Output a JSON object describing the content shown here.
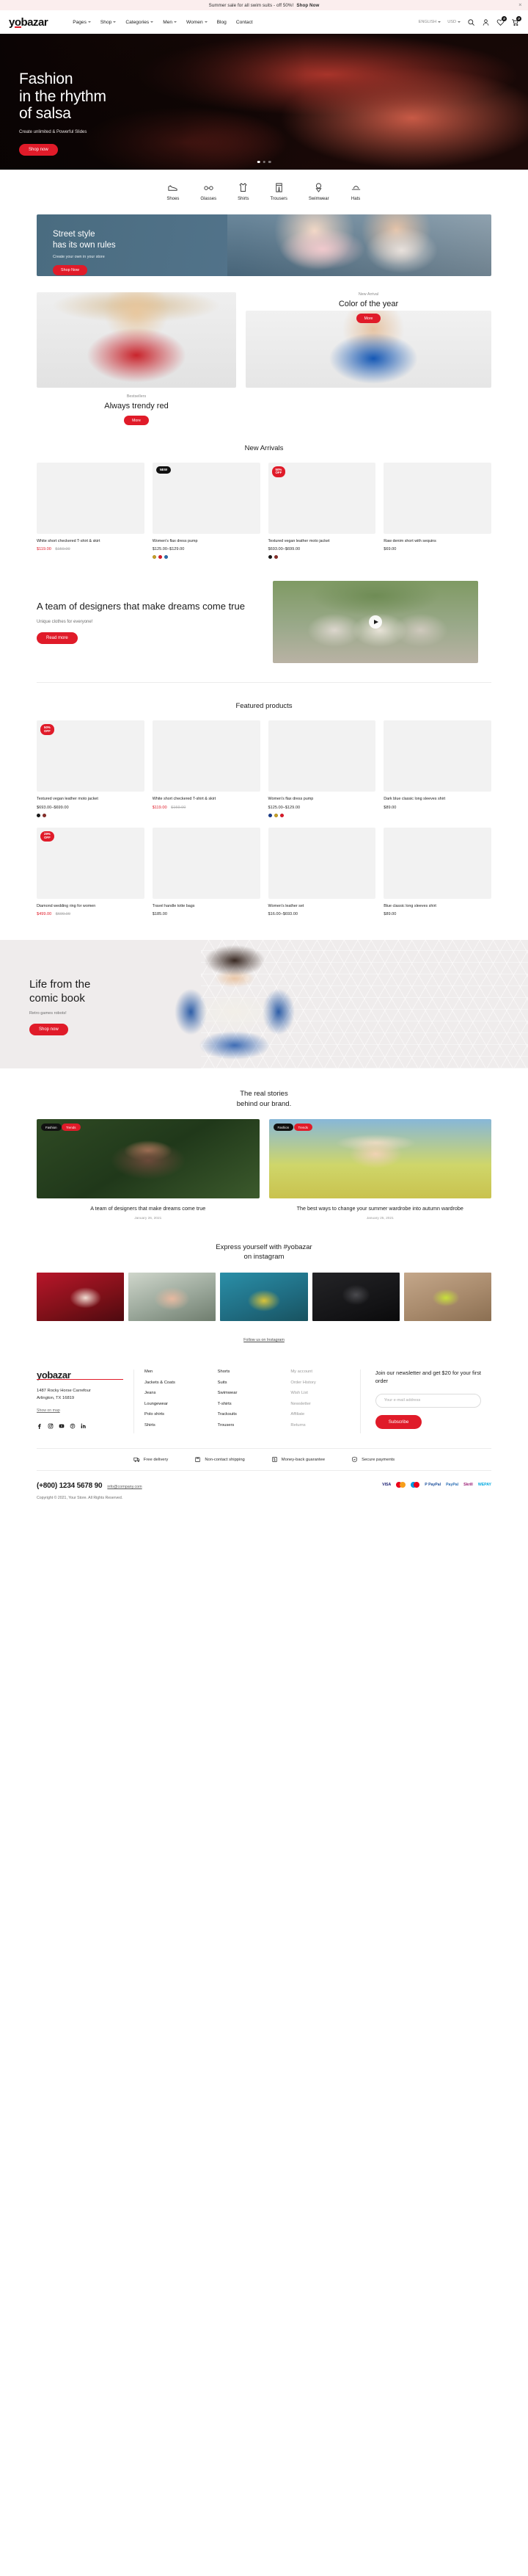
{
  "announce": {
    "text": "Summer sale for all swim suits - off 50%!",
    "cta": "Shop Now",
    "close_icon": "close-icon"
  },
  "header": {
    "logo": "yobazar",
    "nav": [
      {
        "label": "Pages",
        "has_caret": true
      },
      {
        "label": "Shop",
        "has_caret": true
      },
      {
        "label": "Categories",
        "has_caret": true
      },
      {
        "label": "Men",
        "has_caret": true
      },
      {
        "label": "Women",
        "has_caret": true
      },
      {
        "label": "Blog",
        "has_caret": false
      },
      {
        "label": "Contact",
        "has_caret": false
      }
    ],
    "language": "ENGLISH",
    "currency": "USD",
    "wishlist_count": "0",
    "cart_count": "0"
  },
  "hero": {
    "line1": "Fashion",
    "line2": "in the rhythm",
    "line3": "of salsa",
    "subtitle_1": "Create unlimited & Powerful Slides",
    "button": "Shop now"
  },
  "categories": [
    {
      "label": "Shoes",
      "icon": "shoe-icon"
    },
    {
      "label": "Glasses",
      "icon": "glasses-icon"
    },
    {
      "label": "Shirts",
      "icon": "shirt-icon"
    },
    {
      "label": "Trousers",
      "icon": "trousers-icon"
    },
    {
      "label": "Swimwear",
      "icon": "swimwear-icon"
    },
    {
      "label": "Hats",
      "icon": "hat-icon"
    }
  ],
  "street_banner": {
    "line1": "Street style",
    "line2": "has its own rules",
    "subtitle": "Create your own in your store",
    "button": "Shop Now"
  },
  "promos": {
    "left": {
      "eyebrow": "Bestsellers",
      "title": "Always trendy red",
      "button": "More"
    },
    "right": {
      "eyebrow": "New Arrival",
      "title": "Color of the year",
      "button": "More"
    }
  },
  "new_arrivals": {
    "title": "New Arrivals",
    "products": [
      {
        "name": "White short checkered T-shirt & skirt",
        "sale_price": "$119.00",
        "old_price": "$159.00",
        "tag": "",
        "swatches": []
      },
      {
        "name": "Women's flax dress pump",
        "price": "$125.00–$129.00",
        "tag": "NEW",
        "tag_style": "dark",
        "swatches": [
          "#c9a227",
          "#e01b29",
          "#2f6fae"
        ]
      },
      {
        "name": "Textured vegan leather moto jacket",
        "price": "$693.00–$699.00",
        "tag": "50%\nOFF",
        "tag_style": "red",
        "swatches": [
          "#1b1b1b",
          "#8b2f2b"
        ]
      },
      {
        "name": "Raw denim short with sequins",
        "price": "$69.00",
        "tag": "",
        "swatches": []
      }
    ]
  },
  "designers": {
    "title": "A team of designers that make dreams come true",
    "subtitle": "Unique clothes for everyone!",
    "button": "Read more",
    "play_icon": "play-icon"
  },
  "featured": {
    "title": "Featured products",
    "row1": [
      {
        "name": "Textured vegan leather moto jacket",
        "price": "$693.00–$699.00",
        "tag": "50%\nOFF",
        "tag_style": "red",
        "swatches": [
          "#1b1b1b",
          "#8b2f2b"
        ]
      },
      {
        "name": "White short checkered T-shirt & skirt",
        "sale_price": "$119.00",
        "old_price": "$159.00",
        "tag": "",
        "swatches": []
      },
      {
        "name": "Women's flax dress pump",
        "price": "$125.00–$129.00",
        "tag": "",
        "swatches": [
          "#1a3d8f",
          "#c9a227",
          "#e01b29"
        ]
      },
      {
        "name": "Dark blue classic long sleeves shirt",
        "price": "$89.00",
        "tag": "",
        "swatches": []
      }
    ],
    "row2": [
      {
        "name": "Diamond wedding ring for women",
        "sale_price": "$499.00",
        "old_price": "$699.00",
        "tag": "29%\nOFF",
        "tag_style": "red",
        "swatches": []
      },
      {
        "name": "Travel handle totte bags",
        "price": "$185.00",
        "tag": "",
        "swatches": []
      },
      {
        "name": "Women's leather set",
        "price": "$16.00–$693.00",
        "tag": "",
        "swatches": []
      },
      {
        "name": "Blue classic long sleeves shirt",
        "price": "$89.00",
        "tag": "",
        "swatches": []
      }
    ]
  },
  "comic": {
    "line1": "Life from the",
    "line2": "comic book",
    "subtitle": "Retro games robots!",
    "button": "Shop now"
  },
  "stories": {
    "title_line1": "The real stories",
    "title_line2": "behind our brand.",
    "items": [
      {
        "chip1": "Fashion",
        "chip2": "Trends",
        "title": "A team of designers that make dreams come true",
        "date": "January 26, 2021"
      },
      {
        "chip1": "Fashion",
        "chip2": "Trends",
        "title": "The best ways to change your summer wardrobe into autumn wardrobe",
        "date": "January 25, 2021"
      }
    ]
  },
  "instagram": {
    "title_line1": "Express yourself with #yobazar",
    "title_line2": "on instagram",
    "follow": "Follow us on Instagram"
  },
  "footer": {
    "logo": "yobazar",
    "address_line1": "1487 Rocky Horse Carrefour",
    "address_line2": "Arlington, TX 16819",
    "map_link": "Show on map",
    "socials": [
      "facebook-icon",
      "instagram-icon",
      "youtube-icon",
      "pinterest-icon",
      "linkedin-icon"
    ],
    "col1": [
      "Men",
      "Jackets & Coats",
      "Jeans",
      "Loungewear",
      "Polo shirts",
      "Shirts"
    ],
    "col2": [
      "Shorts",
      "Suits",
      "Swimwear",
      "T-shirts",
      "Tracksuits",
      "Trousers"
    ],
    "col3": [
      "My account",
      "Order History",
      "Wish List",
      "Newsletter",
      "Affiliate",
      "Returns"
    ],
    "newsletter_title": "Join our newsletter and get $20 for your first order",
    "email_placeholder": "Your e-mail address",
    "subscribe": "Subscribe",
    "benefits": [
      {
        "label": "Free delivery",
        "icon": "delivery-icon"
      },
      {
        "label": "Non-contact shipping",
        "icon": "box-icon"
      },
      {
        "label": "Money-back guarantee",
        "icon": "refund-icon"
      },
      {
        "label": "Secure payments",
        "icon": "shield-icon"
      }
    ],
    "phone": "(+800) 1234 5678 90",
    "email": "info@company.com",
    "copyright": "Copyright © 2021, Your Store. All Rights Reserved.",
    "payments": [
      "VISA",
      "Mastercard",
      "Maestro",
      "P PayPal",
      "PayPal",
      "Skrill",
      "WEPAY"
    ]
  },
  "colors": {
    "accent": "#e01b29",
    "dark": "#111111",
    "muted": "#9a9a9a"
  }
}
